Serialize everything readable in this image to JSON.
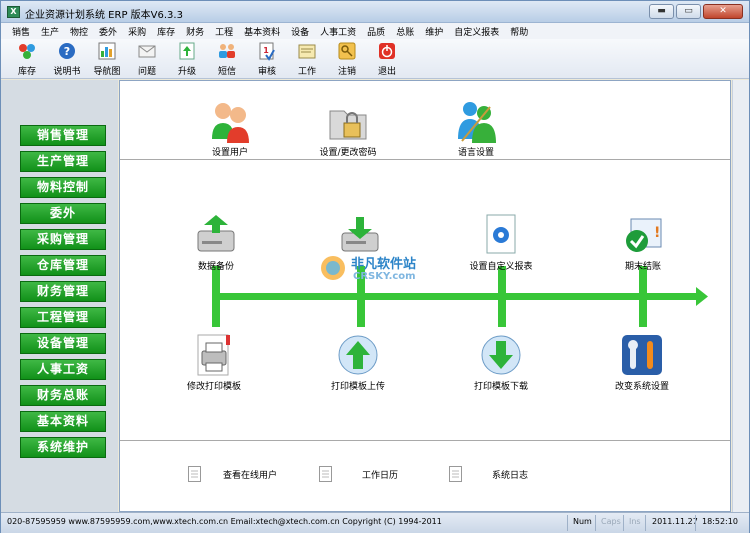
{
  "window": {
    "title": "企业资源计划系统 ERP 版本V6.3.3",
    "app_icon": "X"
  },
  "window_buttons": {
    "minimize": "▬",
    "maximize": "▭",
    "close": "✕"
  },
  "menu": [
    "销售",
    "生产",
    "物控",
    "委外",
    "采购",
    "库存",
    "财务",
    "工程",
    "基本资料",
    "设备",
    "人事工资",
    "品质",
    "总账",
    "维护",
    "自定义报表",
    "帮助"
  ],
  "toolbar": [
    {
      "label": "库存",
      "icon": "inventory-icon"
    },
    {
      "label": "说明书",
      "icon": "help-icon"
    },
    {
      "label": "导航图",
      "icon": "navigation-chart-icon"
    },
    {
      "label": "问题",
      "icon": "question-mail-icon"
    },
    {
      "label": "升级",
      "icon": "upgrade-icon"
    },
    {
      "label": "短信",
      "icon": "sms-users-icon"
    },
    {
      "label": "审核",
      "icon": "audit-icon"
    },
    {
      "label": "工作",
      "icon": "work-icon"
    },
    {
      "label": "注销",
      "icon": "logout-key-icon"
    },
    {
      "label": "退出",
      "icon": "exit-icon"
    }
  ],
  "sidebar": [
    "销售管理",
    "生产管理",
    "物料控制",
    "委外",
    "采购管理",
    "仓库管理",
    "财务管理",
    "工程管理",
    "设备管理",
    "人事工资",
    "财务总账",
    "基本资料",
    "系统维护"
  ],
  "top_items": [
    {
      "label": "设置用户",
      "icon": "users-icon"
    },
    {
      "label": "设置/更改密码",
      "icon": "password-folder-icon"
    },
    {
      "label": "语言设置",
      "icon": "language-icon"
    }
  ],
  "flow_items": [
    {
      "label": "数据备份",
      "icon": "backup-icon"
    },
    {
      "label": "",
      "icon": "restore-icon"
    },
    {
      "label": "设置自定义报表",
      "icon": "custom-report-icon"
    },
    {
      "label": "期末结账",
      "icon": "period-close-icon"
    }
  ],
  "lower_items": [
    {
      "label": "修改打印模板",
      "icon": "printer-icon"
    },
    {
      "label": "打印模板上传",
      "icon": "upload-icon"
    },
    {
      "label": "打印模板下载",
      "icon": "download-icon"
    },
    {
      "label": "改变系统设置",
      "icon": "system-settings-icon"
    }
  ],
  "bottom_links": [
    {
      "label": "查看在线用户",
      "icon": "document-icon"
    },
    {
      "label": "工作日历",
      "icon": "document-icon"
    },
    {
      "label": "系统日志",
      "icon": "document-icon"
    }
  ],
  "watermark": {
    "line1": "非凡软件站",
    "line2": "CRSKY.com"
  },
  "status": {
    "contact": "020-87595959 www.87595959.com,www.xtech.com.cn Email:xtech@xtech.com.cn Copyright (C) 1994-2011",
    "num": "Num",
    "caps": "Caps",
    "ins": "Ins",
    "date": "2011.11.27",
    "time": "18:52:10"
  },
  "colors": {
    "sidebar_button": "#119119",
    "flow_line": "#2fc42f",
    "accent_blue": "#2a6bc2"
  }
}
